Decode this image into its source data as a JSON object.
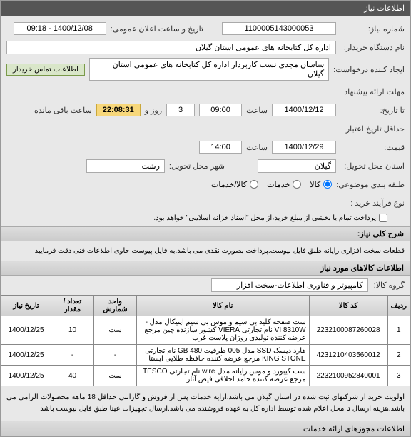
{
  "header": {
    "title": "اطلاعات نیاز"
  },
  "fields": {
    "need_no_label": "شماره نیاز:",
    "need_no": "1100005143000053",
    "announce_label": "تاریخ و ساعت اعلان عمومی:",
    "announce_value": "1400/12/08 - 09:18",
    "buyer_label": "نام دستگاه خریدار:",
    "buyer_value": "اداره کل کتابخانه های عمومی استان گیلان",
    "requester_label": "ایجاد کننده درخواست:",
    "requester_value": "ساسان مجدی نسب کاربردار اداره کل کتابخانه های عمومی استان گیلان",
    "contact_btn": "اطلاعات تماس خریدار",
    "deadline_label": "مهلت ارائه پیشنهاد",
    "deadline_until": "تا تاریخ:",
    "deadline_date": "1400/12/12",
    "time_label": "ساعت",
    "deadline_time": "09:00",
    "days_value": "3",
    "days_label": "روز و",
    "timer": "22:08:31",
    "remain_label": "ساعت باقی مانده",
    "credit_label": "حداقل تاریخ اعتبار",
    "credit_sub": "قیمت:",
    "credit_date": "1400/12/29",
    "credit_time": "14:00",
    "province_label": "استان محل تحویل:",
    "province": "گیلان",
    "city_label": "شهر محل تحویل:",
    "city": "رشت",
    "category_label": "طبقه بندی موضوعی:",
    "radio_goods": "کالا",
    "radio_service": "خدمات",
    "radio_both": "کالا/خدمات",
    "process_label": "نوع فرآیند خرید :",
    "checkbox_note": "پرداخت تمام یا بخشی از مبلغ خرید،از محل \"اسناد خزانه اسلامی\" خواهد بود."
  },
  "sections": {
    "desc_title": "شرح کلی نیاز:",
    "desc_text": "قطعات سخت افزاری رایانه طبق فایل پیوست.پرداخت بصورت نقدی می باشد.به فایل پیوست حاوی اطلاعات فنی دقت فرمایید",
    "goods_title": "اطلاعات کالاهای مورد نیاز",
    "group_label": "گروه کالا:",
    "group_value": "کامپیوتر و فناوری اطلاعات-سخت افزار"
  },
  "table": {
    "headers": [
      "ردیف",
      "کد کالا",
      "نام کالا",
      "واحد شمارش",
      "تعداد / مقدار",
      "تاریخ نیاز"
    ],
    "rows": [
      {
        "n": "1",
        "code": "2232100087260028",
        "name": "ست صفحه کلید بی سیم و موس بی سیم اپتیکال مدل -VI 8310W نام تجارتی VIERA کشور سازنده چین مرجع عرضه کننده تولیدی روژان پلاست غرب",
        "unit": "ست",
        "qty": "10",
        "date": "1400/12/25"
      },
      {
        "n": "2",
        "code": "4231210403560012",
        "name": "هارد دیسک SSD مدل 005 ظرفیت GB 480 نام تجارتی KING STONE مرجع عرضه کننده حافظه طلایی ایستا",
        "unit": "-",
        "qty": "-",
        "date": "1400/12/25"
      },
      {
        "n": "3",
        "code": "2232100952840001",
        "name": "ست کیبورد و موس رایانه مدل wire نام تجارتی TESCO مرجع عرضه کننده حامد اخلاقی فیض آثار",
        "unit": "ست",
        "qty": "40",
        "date": "1400/12/25"
      }
    ]
  },
  "footer": {
    "note": "اولویت خرید از شرکتهای ثبت شده در استان گیلان می باشد.ارایه خدمات پس از فروش و گارانتی حداقل 18 ماهه محصولات الزامی می باشد.هزینه ارسال تا محل اعلام شده توسط اداره کل به عهده فروشنده می باشد.ارسال تجهیزات عینا طبق فایل پیوست باشد",
    "bottom_title": "اطلاعات مجوزهای ارائه خدمات"
  }
}
